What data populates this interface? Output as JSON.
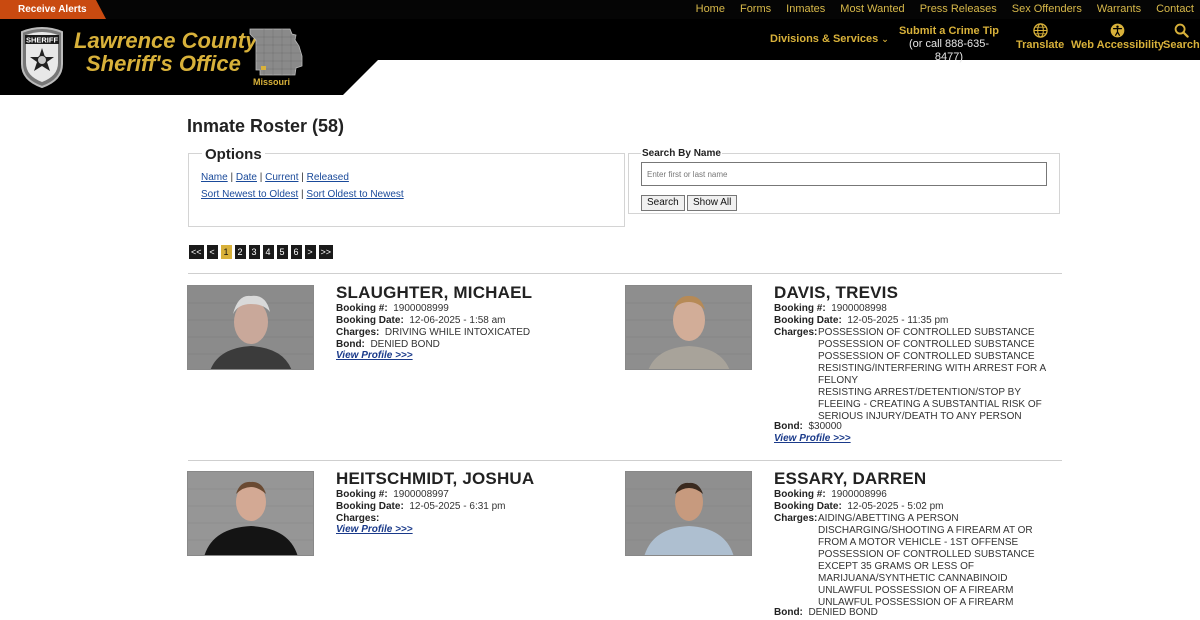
{
  "topbar": {
    "alerts_label": "Receive Alerts",
    "nav": [
      "Home",
      "Forms",
      "Inmates",
      "Most Wanted",
      "Press Releases",
      "Sex Offenders",
      "Warrants",
      "Contact"
    ]
  },
  "header": {
    "brand_line1": "Lawrence County",
    "brand_line2": "Sheriff's Office",
    "state_label": "Missouri",
    "divisions_label": "Divisions & Services",
    "tip_title": "Submit a Crime Tip",
    "tip_phone": "(or call 888-635-8477)",
    "translate_label": "Translate",
    "accessibility_label": "Web Accessibility",
    "search_label": "Search"
  },
  "main": {
    "title": "Inmate Roster (58)",
    "options_title": "Options",
    "options_line1": [
      "Name",
      "Date",
      "Current",
      "Released"
    ],
    "options_line2": [
      "Sort Newest to Oldest",
      "Sort Oldest to Newest"
    ],
    "search_by_name_label": "Search By Name",
    "search_placeholder": "Enter first or last name",
    "search_button": "Search",
    "show_all_button": "Show All",
    "pager": [
      "<<",
      "<",
      "1",
      "2",
      "3",
      "4",
      "5",
      "6",
      ">",
      ">>"
    ],
    "active_page": "1"
  },
  "labels": {
    "booking_no": "Booking #:",
    "booking_date": "Booking Date:",
    "charges": "Charges:",
    "bond": "Bond:",
    "view_profile": "View Profile >>>"
  },
  "inmates": [
    {
      "name": "SLAUGHTER, MICHAEL",
      "booking_no": "1900008999",
      "booking_date": "12-06-2025 - 1:58 am",
      "charges": [
        "DRIVING WHILE INTOXICATED"
      ],
      "bond": "DENIED BOND"
    },
    {
      "name": "DAVIS, TREVIS",
      "booking_no": "1900008998",
      "booking_date": "12-05-2025 - 11:35 pm",
      "charges": [
        "POSSESSION OF CONTROLLED SUBSTANCE",
        "POSSESSION OF CONTROLLED SUBSTANCE",
        "POSSESSION OF CONTROLLED SUBSTANCE",
        "RESISTING/INTERFERING WITH ARREST FOR A FELONY",
        "RESISTING ARREST/DETENTION/STOP BY FLEEING - CREATING A SUBSTANTIAL RISK OF SERIOUS INJURY/DEATH TO ANY PERSON"
      ],
      "bond": "$30000"
    },
    {
      "name": "HEITSCHMIDT, JOSHUA",
      "booking_no": "1900008997",
      "booking_date": "12-05-2025 - 6:31 pm",
      "charges": [],
      "bond": ""
    },
    {
      "name": "ESSARY, DARREN",
      "booking_no": "1900008996",
      "booking_date": "12-05-2025 - 5:02 pm",
      "charges": [
        "AIDING/ABETTING A PERSON DISCHARGING/SHOOTING A FIREARM AT OR FROM A MOTOR VEHICLE - 1ST OFFENSE",
        "POSSESSION OF CONTROLLED SUBSTANCE EXCEPT 35 GRAMS OR LESS OF MARIJUANA/SYNTHETIC CANNABINOID",
        "UNLAWFUL POSSESSION OF A FIREARM",
        "UNLAWFUL POSSESSION OF A FIREARM"
      ],
      "bond": "DENIED BOND"
    }
  ]
}
